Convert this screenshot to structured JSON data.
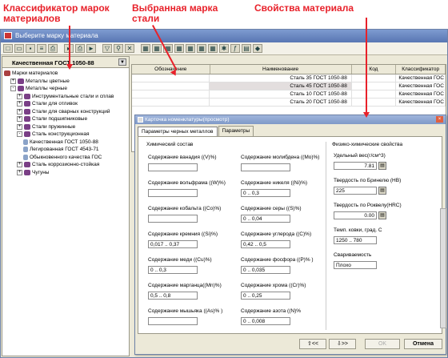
{
  "annotations": {
    "classifier_label": "Классификатор марок материалов",
    "selected_grade_label": "Выбранная марка стали",
    "properties_label": "Свойства материала"
  },
  "window": {
    "title": "Выберите марку материала"
  },
  "toolbar_icons": [
    "new-icon",
    "open-icon",
    "save-icon",
    "list-icon",
    "print-icon",
    "export-icon",
    "printer-icon",
    "arrow-icon",
    "filter-icon",
    "search-icon",
    "tools-icon",
    "table-icon",
    "table-icon",
    "table-icon",
    "table-icon",
    "table-icon",
    "table-icon",
    "table-icon",
    "star-icon",
    "formula-icon",
    "grid-icon",
    "lock-icon"
  ],
  "left_pane": {
    "header": "Качественная ГОСТ 1050-88",
    "tree": [
      {
        "label": "Марки материалов",
        "level": 0,
        "toggle": "",
        "icon": "root"
      },
      {
        "label": "Металлы цветные",
        "level": 1,
        "toggle": "+",
        "icon": "book"
      },
      {
        "label": "Металлы черные",
        "level": 1,
        "toggle": "-",
        "icon": "book"
      },
      {
        "label": "Инструментальные стали и сплав",
        "level": 2,
        "toggle": "+",
        "icon": "book"
      },
      {
        "label": "Стали для отливок",
        "level": 2,
        "toggle": "+",
        "icon": "book"
      },
      {
        "label": "Стали для сварных конструкций",
        "level": 2,
        "toggle": "+",
        "icon": "book"
      },
      {
        "label": "Стали подшипниковые",
        "level": 2,
        "toggle": "+",
        "icon": "book"
      },
      {
        "label": "Стали пружинные",
        "level": 2,
        "toggle": "+",
        "icon": "book"
      },
      {
        "label": "Сталь конструкционная",
        "level": 2,
        "toggle": "-",
        "icon": "sel"
      },
      {
        "label": "Качественная ГОСТ 1050-88",
        "level": 3,
        "toggle": "",
        "icon": "doc"
      },
      {
        "label": "Легированная ГОСТ 4543-71",
        "level": 3,
        "toggle": "",
        "icon": "doc"
      },
      {
        "label": "Обыкновенного качества ГОС",
        "level": 3,
        "toggle": "",
        "icon": "doc"
      },
      {
        "label": "Сталь коррозионно-стойкая",
        "level": 2,
        "toggle": "+",
        "icon": "book"
      },
      {
        "label": "Чугуны",
        "level": 2,
        "toggle": "+",
        "icon": "book"
      }
    ]
  },
  "grid": {
    "columns": [
      "Обозначение",
      "Наименование",
      "Код",
      "Классификатор"
    ],
    "rows": [
      {
        "name": "Сталь 35 ГОСТ 1050-88",
        "code": "",
        "classifier": "Качественная ГОС",
        "selected": false
      },
      {
        "name": "Сталь 45 ГОСТ 1050-88",
        "code": "",
        "classifier": "Качественная ГОС",
        "selected": true
      },
      {
        "name": "Сталь 10 ГОСТ 1050-88",
        "code": "",
        "classifier": "Качественная ГОС",
        "selected": false
      },
      {
        "name": "Сталь 20 ГОСТ 1050-88",
        "code": "",
        "classifier": "Качественная ГОС",
        "selected": false
      }
    ]
  },
  "card": {
    "title": "Карточка номенклатуры(просмотр)",
    "tabs": [
      "Параметры черных металлов",
      "Параметры"
    ],
    "chem_header": "Химический состав",
    "phys_header": "Физико-химические свойства",
    "chem_left": [
      {
        "label": "Содержание ванадия ((V)%)",
        "value": ""
      },
      {
        "label": "Содержание вольфрама ((W)%)",
        "value": ""
      },
      {
        "label": "Содержание кобальта ((Co)%)",
        "value": ""
      },
      {
        "label": "Содержание кремния ((Si)%)",
        "value": "0,017 .. 0,37"
      },
      {
        "label": "Содержание меди ((Cu)%)",
        "value": "0 .. 0,3"
      },
      {
        "label": "Содержание марганца((Mn)%)",
        "value": "0,5 .. 0,8"
      },
      {
        "label": "Содержание мышьяка ((As)% )",
        "value": ""
      }
    ],
    "chem_right": [
      {
        "label": "Содержание молибдена ((Mo)%)",
        "value": ""
      },
      {
        "label": "Содержание никеля ((Ni)%)",
        "value": "0 .. 0,3"
      },
      {
        "label": "Содержание серы ((S)%)",
        "value": "0 .. 0,04"
      },
      {
        "label": "Содержание углерода ((C)%)",
        "value": "0,42 .. 0,5"
      },
      {
        "label": "Содержание фосфора ((P)% )",
        "value": "0 .. 0,035"
      },
      {
        "label": "Содержание хрома ((Cr)%)",
        "value": "0 .. 0,25"
      },
      {
        "label": "Содержание азота ((N)%",
        "value": "0 .. 0,008"
      }
    ],
    "phys": [
      {
        "label": "Удельный вес(г/см^3)",
        "value": "7.81",
        "btn": true
      },
      {
        "label": "Твердость по Бринелю (НВ)",
        "value": "225",
        "btn": true
      },
      {
        "label": "Твердость по Роквелу(HRC)",
        "value": "0.00",
        "btn": true
      },
      {
        "label": "Темп. ковки, град. С",
        "value": "1250 .. 780",
        "btn": false
      },
      {
        "label": "Свариваемость",
        "value": "Плохо",
        "btn": false
      }
    ],
    "buttons": {
      "prev": "⇧<<",
      "next": "⇩>>",
      "ok": "OK",
      "cancel": "Отмена"
    }
  }
}
